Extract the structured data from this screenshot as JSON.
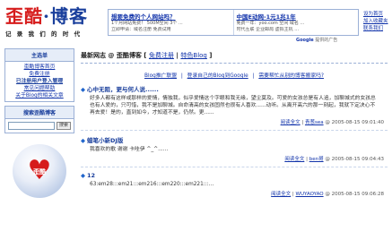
{
  "header": {
    "logo_red": "歪酷",
    "logo_sep": "·",
    "logo_blue": "博客",
    "tagline": "记 录 我 们 的 时 代"
  },
  "ads": [
    {
      "title": "想要免费的个人网站吗？",
      "lines": [
        "1个月网站免费！ 500M空间 3个 ...",
        "立即申请：域名注册 免费试用"
      ]
    },
    {
      "title": "中国E动网-1元1兆1年",
      "lines": [
        "免费一年：yoo.com 空间 域名 ...",
        "时代互联 企业邮局 虚拟主机 ..."
      ]
    }
  ],
  "ad_footer": {
    "brand": "Google",
    "text": "提供的广告"
  },
  "top_links": [
    "设为首页",
    "加入收藏夹",
    "联系我们"
  ],
  "sidebar": {
    "nav_title": "主选单",
    "nav_items": [
      "歪酷博客首页",
      "免费注册",
      "已注册用户登入管理",
      "常见问题帮助",
      "关于Blog的相关文章"
    ],
    "search_title": "搜索歪酷博客",
    "search_button": "搜索",
    "badge_text": "歪酷"
  },
  "main": {
    "title": "最新网志 @ 歪酷博客",
    "title_link1": "免费注册",
    "title_link2": "特色Blog",
    "sub_links": [
      "Blog推广联盟",
      "登录自己的Blog到Google",
      "需要帮忙从别的博客搬家吗?"
    ],
    "posts": [
      {
        "title": "心中无阻，更与何人说......",
        "body": "好多人都有这样或那样的爱情，情独我，似乎爱情这个字眼和我无缘，望尘莫及。可爱的女孩总是有人追，加聊城式的女孩总也有人爱的，只可惜，我不是加聊城。自命清高的女孩固然也很有人喜欢......动听。从离开高六的那一刻起，我就下定决心不再去爱！是的，直到如今，才知道不是，仍然。更......",
        "read": "阅读全文",
        "author": "青葱sea",
        "time": "@ 2005-08-15 09:01:40"
      },
      {
        "title": "蜡笔小新DJ版",
        "body": "我喜欢的歌 谢谢 卡哇伊 ^_^......",
        "read": "阅读全文",
        "author": "ben哥",
        "time": "@ 2005-08-15 09:04:43"
      },
      {
        "title": "12",
        "body": "63:em28:::em21:::em216:::em220:::em221:::...",
        "read": "阅读全文",
        "author": "WUYAOYAO",
        "time": "@ 2005-08-15 09:06:28"
      }
    ]
  }
}
